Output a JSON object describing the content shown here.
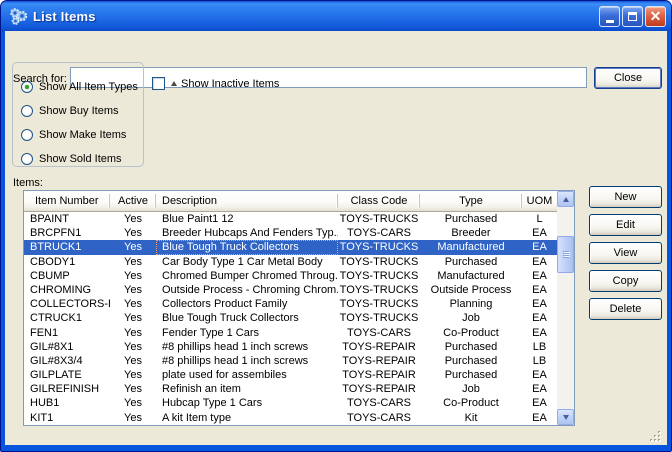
{
  "window": {
    "title": "List Items"
  },
  "search": {
    "label": "Search for:",
    "value": "",
    "close_button": "Close"
  },
  "filters": {
    "radios": [
      {
        "label": "Show All Item Types",
        "selected": true
      },
      {
        "label": "Show Buy Items",
        "selected": false
      },
      {
        "label": "Show Make Items",
        "selected": false
      },
      {
        "label": "Show Sold Items",
        "selected": false
      }
    ],
    "inactive_checkbox": {
      "label": "Show Inactive Items",
      "checked": false
    }
  },
  "items": {
    "label": "Items:",
    "columns": [
      "Item Number",
      "Active",
      "Description",
      "Class Code",
      "Type",
      "UOM"
    ],
    "selected_row": 2,
    "rows": [
      [
        "BPAINT",
        "Yes",
        "Blue Paint1 12",
        "TOYS-TRUCKS",
        "Purchased",
        "L"
      ],
      [
        "BRCPFN1",
        "Yes",
        "Breeder Hubcaps And Fenders Typ...",
        "TOYS-CARS",
        "Breeder",
        "EA"
      ],
      [
        "BTRUCK1",
        "Yes",
        "Blue Tough Truck Collectors",
        "TOYS-TRUCKS",
        "Manufactured",
        "EA"
      ],
      [
        "CBODY1",
        "Yes",
        "Car Body Type 1 Car Metal Body",
        "TOYS-TRUCKS",
        "Purchased",
        "EA"
      ],
      [
        "CBUMP",
        "Yes",
        "Chromed Bumper Chromed Throug...",
        "TOYS-TRUCKS",
        "Manufactured",
        "EA"
      ],
      [
        "CHROMING",
        "Yes",
        "Outside Process - Chroming Chrom...",
        "TOYS-TRUCKS",
        "Outside Process",
        "EA"
      ],
      [
        "COLLECTORS-LINE",
        "Yes",
        "Collectors Product Family",
        "TOYS-TRUCKS",
        "Planning",
        "EA"
      ],
      [
        "CTRUCK1",
        "Yes",
        "Blue Tough Truck Collectors",
        "TOYS-TRUCKS",
        "Job",
        "EA"
      ],
      [
        "FEN1",
        "Yes",
        "Fender Type 1 Cars",
        "TOYS-CARS",
        "Co-Product",
        "EA"
      ],
      [
        "GIL#8X1",
        "Yes",
        "#8 phillips head 1 inch screws",
        "TOYS-REPAIR",
        "Purchased",
        "LB"
      ],
      [
        "GIL#8X3/4",
        "Yes",
        "#8 phillips head 1 inch screws",
        "TOYS-REPAIR",
        "Purchased",
        "LB"
      ],
      [
        "GILPLATE",
        "Yes",
        "plate used for assembiles",
        "TOYS-REPAIR",
        "Purchased",
        "EA"
      ],
      [
        "GILREFINISH",
        "Yes",
        "Refinish an item",
        "TOYS-REPAIR",
        "Job",
        "EA"
      ],
      [
        "HUB1",
        "Yes",
        "Hubcap Type 1 Cars",
        "TOYS-CARS",
        "Co-Product",
        "EA"
      ],
      [
        "KIT1",
        "Yes",
        "A kit Item type",
        "TOYS-CARS",
        "Kit",
        "EA"
      ]
    ]
  },
  "actions": [
    "New",
    "Edit",
    "View",
    "Copy",
    "Delete"
  ],
  "colors": {
    "titlebar_blue": "#1F6BE6",
    "window_border": "#0855DD",
    "dialog_bg": "#ECE9D8",
    "selection_blue": "#2F63C5",
    "radio_dot_green": "#2FA32F"
  }
}
